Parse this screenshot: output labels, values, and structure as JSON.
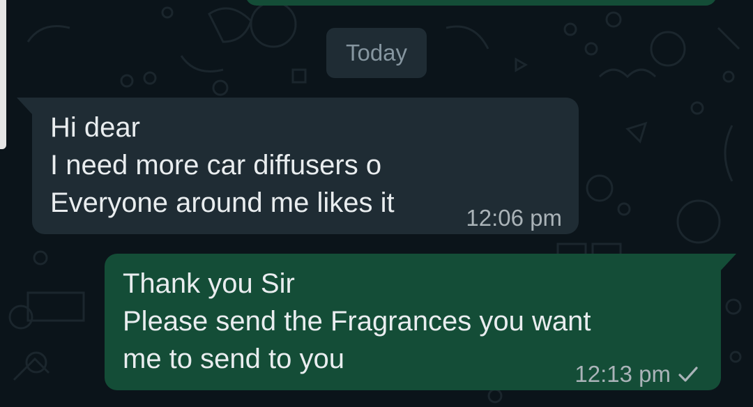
{
  "chat": {
    "date_divider": "Today",
    "messages": [
      {
        "direction": "incoming",
        "lines": [
          "Hi dear",
          "I need more car diffusers o",
          "Everyone around me likes it"
        ],
        "time": "12:06 pm"
      },
      {
        "direction": "outgoing",
        "lines": [
          "Thank you Sir",
          "Please send the Fragrances you want",
          "me to send to you"
        ],
        "time": "12:13 pm",
        "status_icon": "single-check-icon"
      }
    ]
  },
  "colors": {
    "background": "#0b141a",
    "incoming_bubble": "#1f2c34",
    "outgoing_bubble": "#144d37",
    "text": "#e9edef",
    "meta_text": "#aab3b8"
  }
}
